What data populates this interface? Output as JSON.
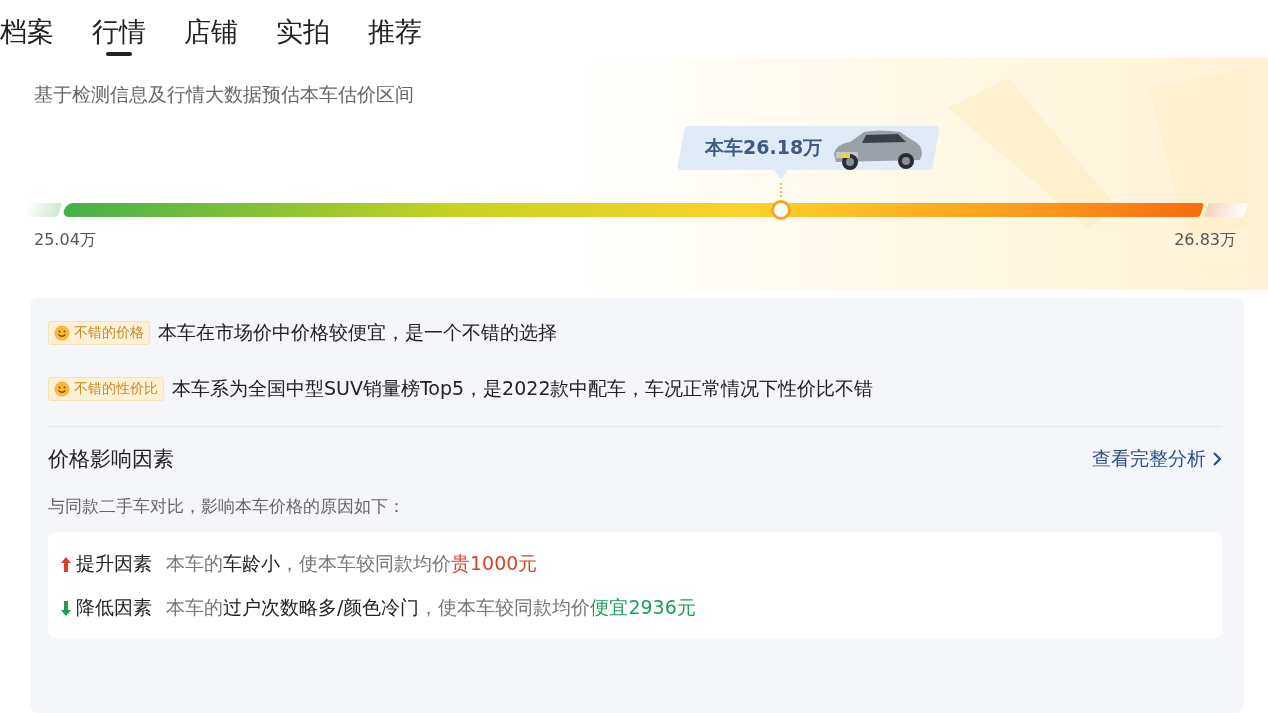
{
  "tabs": [
    {
      "label": "档案",
      "selected": false
    },
    {
      "label": "行情",
      "selected": true
    },
    {
      "label": "店铺",
      "selected": false
    },
    {
      "label": "实拍",
      "selected": false
    },
    {
      "label": "推荐",
      "selected": false
    }
  ],
  "estimate": {
    "note": "基于检测信息及行情大数据预估本车估价区间",
    "current_label": "本车26.18万",
    "level": 0.63,
    "min_label": "25.04万",
    "max_label": "26.83万"
  },
  "verdicts": [
    {
      "tag": "不错的价格",
      "text": "本车在市场价中价格较便宜，是一个不错的选择"
    },
    {
      "tag": "不错的性价比",
      "text": "本车系为全国中型SUV销量榜Top5，是2022款中配车，车况正常情况下性价比不错"
    }
  ],
  "factors": {
    "title": "价格影响因素",
    "link": "查看完整分析",
    "subtitle": "与同款二手车对比，影响本车价格的原因如下：",
    "items": [
      {
        "kind": "up",
        "label": "提升因素",
        "parts": [
          {
            "kind": "muted",
            "text": "本车的"
          },
          {
            "kind": "strong",
            "text": "车龄小"
          },
          {
            "kind": "muted",
            "text": "，使本车较同款均价"
          },
          {
            "kind": "amount",
            "text": "贵1000元"
          }
        ]
      },
      {
        "kind": "down",
        "label": "降低因素",
        "parts": [
          {
            "kind": "muted",
            "text": "本车的"
          },
          {
            "kind": "strong",
            "text": "过户次数略多/颜色冷门"
          },
          {
            "kind": "muted",
            "text": "，使本车较同款均价"
          },
          {
            "kind": "amount",
            "text": "便宜2936元"
          }
        ]
      }
    ]
  }
}
